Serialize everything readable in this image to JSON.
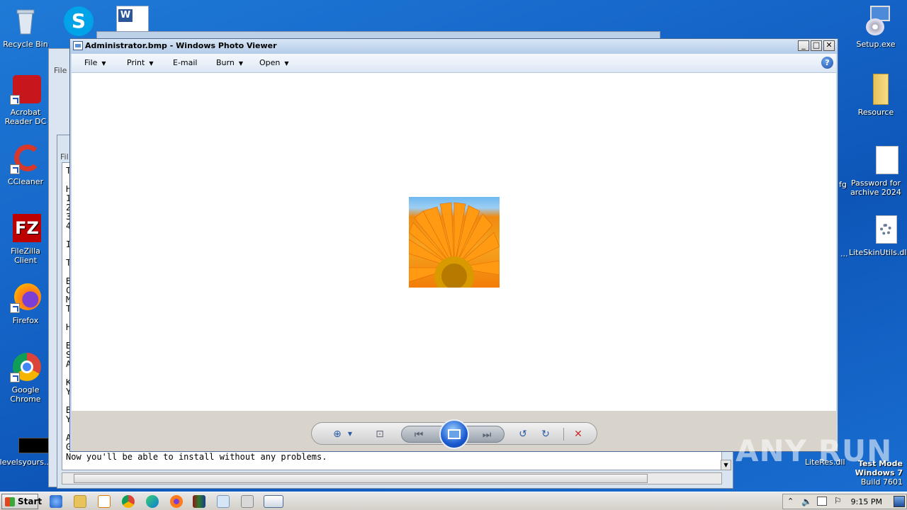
{
  "desktop": {
    "icons_left": [
      {
        "label": "Recycle Bin"
      },
      {
        "label": "Acrobat Reader DC"
      },
      {
        "label": "CCleaner"
      },
      {
        "label": "FileZilla Client"
      },
      {
        "label": "Firefox"
      },
      {
        "label": "Google Chrome"
      },
      {
        "label": "levelsyours..."
      }
    ],
    "icons_right": [
      {
        "label": "Setup.exe"
      },
      {
        "label": "Resource"
      },
      {
        "label": "Password for archive 2024"
      },
      {
        "label": "LiteSkinUtils.dll"
      },
      {
        "label": "LiteRes.dll"
      }
    ],
    "partial_labels": {
      "fg": "fg",
      "dots": "..."
    }
  },
  "notepad": {
    "menu_label": "File",
    "menu_label_2": "Fil",
    "lines": [
      "T",
      "H",
      "1",
      "2",
      "3",
      "4",
      "I",
      "T",
      "B",
      "C",
      "M",
      "T",
      "H",
      "B",
      "S",
      "A",
      "K",
      "Y",
      "B",
      "Y",
      "A",
      "G"
    ],
    "last_line": "Now you'll be able to install without any problems."
  },
  "photo_viewer": {
    "title": "Administrator.bmp - Windows Photo Viewer",
    "menu": [
      "File",
      "Print",
      "E-mail",
      "Burn",
      "Open"
    ],
    "help": "?",
    "window_buttons": {
      "minimize": "_",
      "maximize": "□",
      "close": "✕"
    }
  },
  "taskbar": {
    "start_label": "Start",
    "clock": "9:15 PM"
  },
  "overlay": {
    "watermark": "ANY RUN",
    "testmode": [
      "Test Mode",
      "Windows 7",
      "Build 7601"
    ]
  },
  "colors": {
    "accent": "#2a5aa7",
    "delete": "#cc2b2b"
  }
}
